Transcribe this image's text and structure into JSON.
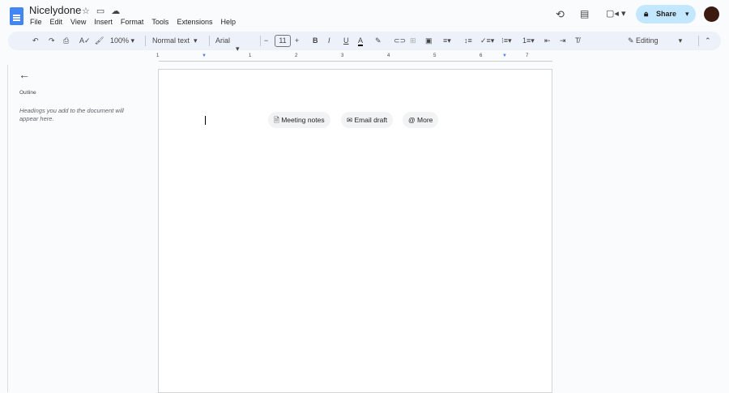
{
  "doc_title": "Nicelydone",
  "menu": [
    "File",
    "Edit",
    "View",
    "Insert",
    "Format",
    "Tools",
    "Extensions",
    "Help"
  ],
  "toolbar": {
    "zoom": "100%",
    "style": "Normal text",
    "font": "Arial",
    "font_size": "11",
    "mode": "Editing"
  },
  "share_label": "Share",
  "ruler_labels": [
    "1",
    "1",
    "2",
    "3",
    "4",
    "5",
    "6",
    "7"
  ],
  "outline": {
    "title": "Outline",
    "empty": "Headings you add to the document will appear here."
  },
  "chips": [
    "Meeting notes",
    "Email draft",
    "More"
  ]
}
